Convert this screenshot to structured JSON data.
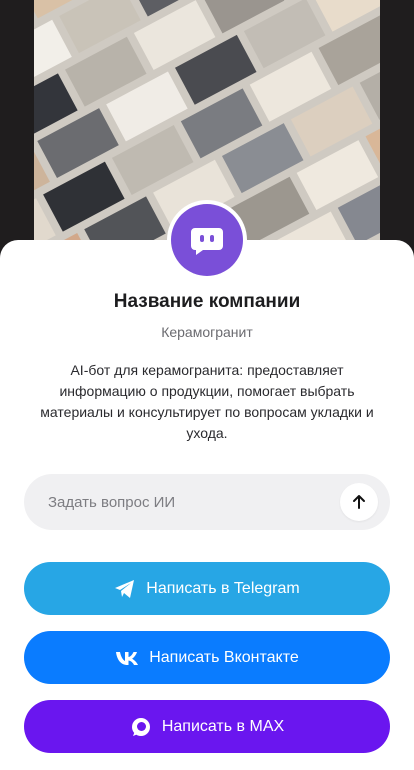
{
  "company": {
    "name": "Название компании",
    "category": "Керамогранит",
    "description": "AI-бот для керамогранита: предоставляет информацию о продукции, помогает выбрать материалы и консультирует по вопросам укладки и ухода."
  },
  "ask": {
    "placeholder": "Задать вопрос ИИ"
  },
  "buttons": {
    "telegram": "Написать в Telegram",
    "vk": "Написать Вконтакте",
    "max": "Написать в MAX"
  },
  "colors": {
    "avatar": "#7a4fd8",
    "telegram": "#27a6e5",
    "vk": "#0a7cff",
    "max": "#6a16ef"
  },
  "icons": {
    "avatar": "chat-bot-icon",
    "send": "arrow-up-icon",
    "telegram": "telegram-icon",
    "vk": "vk-icon",
    "max": "max-chat-icon"
  }
}
